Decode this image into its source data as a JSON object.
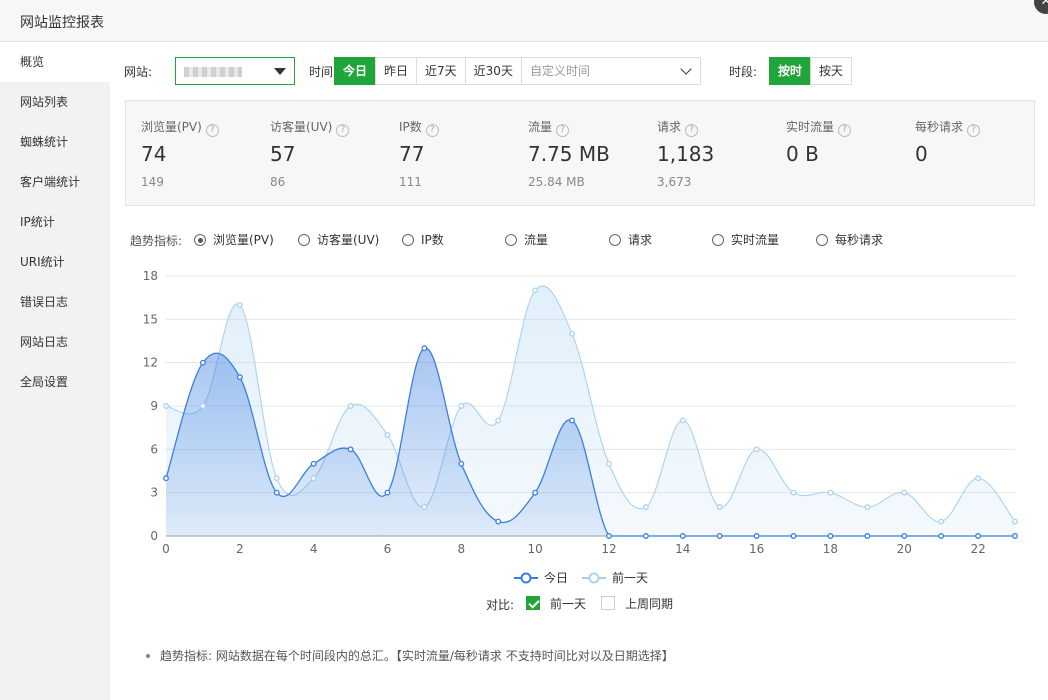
{
  "window": {
    "title": "网站监控报表"
  },
  "sidebar": {
    "items": [
      {
        "label": "概览",
        "active": true
      },
      {
        "label": "网站列表"
      },
      {
        "label": "蜘蛛统计"
      },
      {
        "label": "客户端统计"
      },
      {
        "label": "IP统计"
      },
      {
        "label": "URI统计"
      },
      {
        "label": "错误日志"
      },
      {
        "label": "网站日志"
      },
      {
        "label": "全局设置"
      }
    ]
  },
  "filters": {
    "site_label": "网站:",
    "time_label": "时间:",
    "time_buttons": [
      "今日",
      "昨日",
      "近7天",
      "近30天"
    ],
    "custom_time_placeholder": "自定义时间",
    "period_label": "时段:",
    "period_buttons": [
      "按时",
      "按天"
    ]
  },
  "stats": [
    {
      "label": "浏览量(PV)",
      "value": "74",
      "prev": "149"
    },
    {
      "label": "访客量(UV)",
      "value": "57",
      "prev": "86"
    },
    {
      "label": "IP数",
      "value": "77",
      "prev": "111"
    },
    {
      "label": "流量",
      "value": "7.75 MB",
      "prev": "25.84 MB"
    },
    {
      "label": "请求",
      "value": "1,183",
      "prev": "3,673"
    },
    {
      "label": "实时流量",
      "value": "0 B",
      "prev": ""
    },
    {
      "label": "每秒请求",
      "value": "0",
      "prev": ""
    }
  ],
  "trend": {
    "label": "趋势指标:",
    "options": [
      "浏览量(PV)",
      "访客量(UV)",
      "IP数",
      "流量",
      "请求",
      "实时流量",
      "每秒请求"
    ],
    "selected": 0
  },
  "compare": {
    "label": "对比:",
    "options": [
      {
        "label": "前一天",
        "checked": true
      },
      {
        "label": "上周同期",
        "checked": false
      }
    ]
  },
  "note": "趋势指标: 网站数据在每个时间段内的总汇。【实时流量/每秒请求 不支持时间比对以及日期选择】",
  "chart_data": {
    "type": "area",
    "x": [
      0,
      1,
      2,
      3,
      4,
      5,
      6,
      7,
      8,
      9,
      10,
      11,
      12,
      13,
      14,
      15,
      16,
      17,
      18,
      19,
      20,
      21,
      22,
      23
    ],
    "xticks": [
      0,
      2,
      4,
      6,
      8,
      10,
      12,
      14,
      16,
      18,
      20,
      22
    ],
    "ylim": [
      0,
      18
    ],
    "yticks": [
      0,
      3,
      6,
      9,
      12,
      15,
      18
    ],
    "grid": true,
    "legend_position": "bottom",
    "series": [
      {
        "name": "今日",
        "color": "#3b7fe0",
        "values": [
          4,
          12,
          11,
          3,
          5,
          6,
          3,
          13,
          5,
          1,
          3,
          8,
          0,
          0,
          0,
          0,
          0,
          0,
          0,
          0,
          0,
          0,
          0,
          0
        ]
      },
      {
        "name": "前一天",
        "color": "#a9d2f2",
        "values": [
          9,
          9,
          16,
          4,
          4,
          9,
          7,
          2,
          9,
          8,
          17,
          14,
          5,
          2,
          8,
          2,
          6,
          3,
          3,
          2,
          3,
          1,
          4,
          1
        ]
      }
    ]
  }
}
